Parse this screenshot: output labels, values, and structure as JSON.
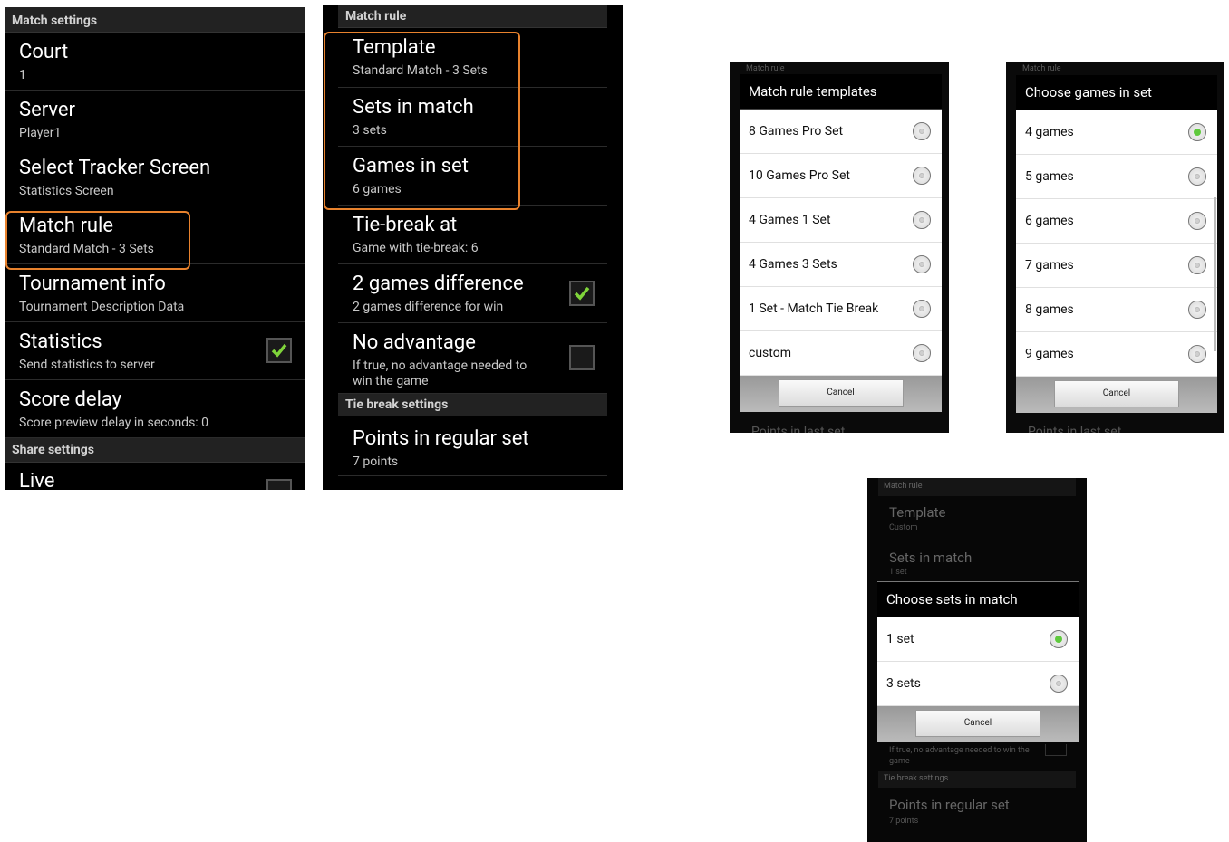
{
  "screen1": {
    "section1": "Match settings",
    "items": [
      {
        "title": "Court",
        "summary": "1"
      },
      {
        "title": "Server",
        "summary": "Player1"
      },
      {
        "title": "Select Tracker Screen",
        "summary": "Statistics Screen"
      },
      {
        "title": "Match rule",
        "summary": "Standard Match - 3 Sets"
      },
      {
        "title": "Tournament info",
        "summary": "Tournament Description Data"
      },
      {
        "title": "Statistics",
        "summary": "Send statistics to server",
        "checked": true
      },
      {
        "title": "Score delay",
        "summary": "Score preview delay in seconds: 0"
      }
    ],
    "section2": "Share settings",
    "partial": "Live"
  },
  "screen2": {
    "section1": "Match rule",
    "items": [
      {
        "title": "Template",
        "summary": "Standard Match - 3 Sets"
      },
      {
        "title": "Sets in match",
        "summary": "3 sets"
      },
      {
        "title": "Games in set",
        "summary": "6 games"
      },
      {
        "title": "Tie-break at",
        "summary": "Game with tie-break: 6"
      },
      {
        "title": "2 games difference",
        "summary": "2 games difference for win",
        "checked": true
      },
      {
        "title": "No advantage",
        "summary": "If true, no advantage needed to win the game",
        "checked": false
      }
    ],
    "section2": "Tie break settings",
    "item_last": {
      "title": "Points in regular set",
      "summary": "7 points"
    }
  },
  "dialog_templates": {
    "bg_header": "Match rule",
    "title": "Match rule templates",
    "options": [
      "8 Games Pro Set",
      "10 Games Pro Set",
      "4 Games 1 Set",
      "4 Games 3 Sets",
      "1 Set - Match Tie Break",
      "custom"
    ],
    "selected": -1,
    "cancel": "Cancel",
    "bg_footer": "Points in last set"
  },
  "dialog_games": {
    "bg_header": "Match rule",
    "title": "Choose games in set",
    "options": [
      "4 games",
      "5 games",
      "6 games",
      "7 games",
      "8 games",
      "9 games"
    ],
    "selected": 0,
    "cancel": "Cancel",
    "bg_footer": "Points in last set"
  },
  "dialog_sets": {
    "bg_header": "Match rule",
    "bg_template_title": "Template",
    "bg_template_summary": "Custom",
    "bg_sets_title": "Sets in match",
    "bg_sets_summary": "1 set",
    "title": "Choose sets in match",
    "options": [
      "1 set",
      "3 sets"
    ],
    "selected": 0,
    "cancel": "Cancel",
    "bg_noadv_summary": "If true, no advantage needed to win the game",
    "bg_section": "Tie break settings",
    "bg_last_title": "Points in regular set",
    "bg_last_summary": "7 points"
  },
  "colors": {
    "highlight": "#e8822d",
    "check": "#7fd43a",
    "radio_on": "#5fc93d"
  }
}
